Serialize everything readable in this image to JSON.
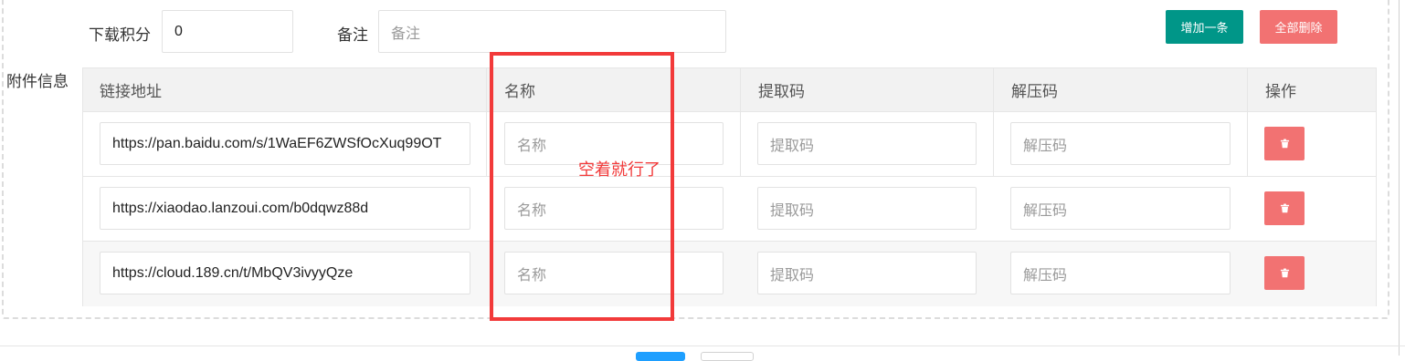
{
  "top_form": {
    "download_points_label": "下载积分",
    "download_points_value": "0",
    "remark_label": "备注",
    "remark_placeholder": "备注"
  },
  "buttons": {
    "add_row": "增加一条",
    "delete_all": "全部删除"
  },
  "attachments": {
    "section_label": "附件信息",
    "columns": [
      "链接地址",
      "名称",
      "提取码",
      "解压码",
      "操作"
    ],
    "rows": [
      {
        "url": "https://pan.baidu.com/s/1WaEF6ZWSfOcXuq99OT",
        "name_placeholder": "名称",
        "code_placeholder": "提取码",
        "unzip_placeholder": "解压码"
      },
      {
        "url": "https://xiaodao.lanzoui.com/b0dqwz88d",
        "name_placeholder": "名称",
        "code_placeholder": "提取码",
        "unzip_placeholder": "解压码"
      },
      {
        "url": "https://cloud.189.cn/t/MbQV3ivyyQze",
        "name_placeholder": "名称",
        "code_placeholder": "提取码",
        "unzip_placeholder": "解压码"
      }
    ]
  },
  "annotation": {
    "text": "空着就行了",
    "color": "#f23a3a"
  },
  "icons": {
    "delete_row": "trash-icon"
  },
  "colors": {
    "primary": "#009688",
    "danger": "#f27272",
    "header_bg": "#f2f2f2"
  }
}
